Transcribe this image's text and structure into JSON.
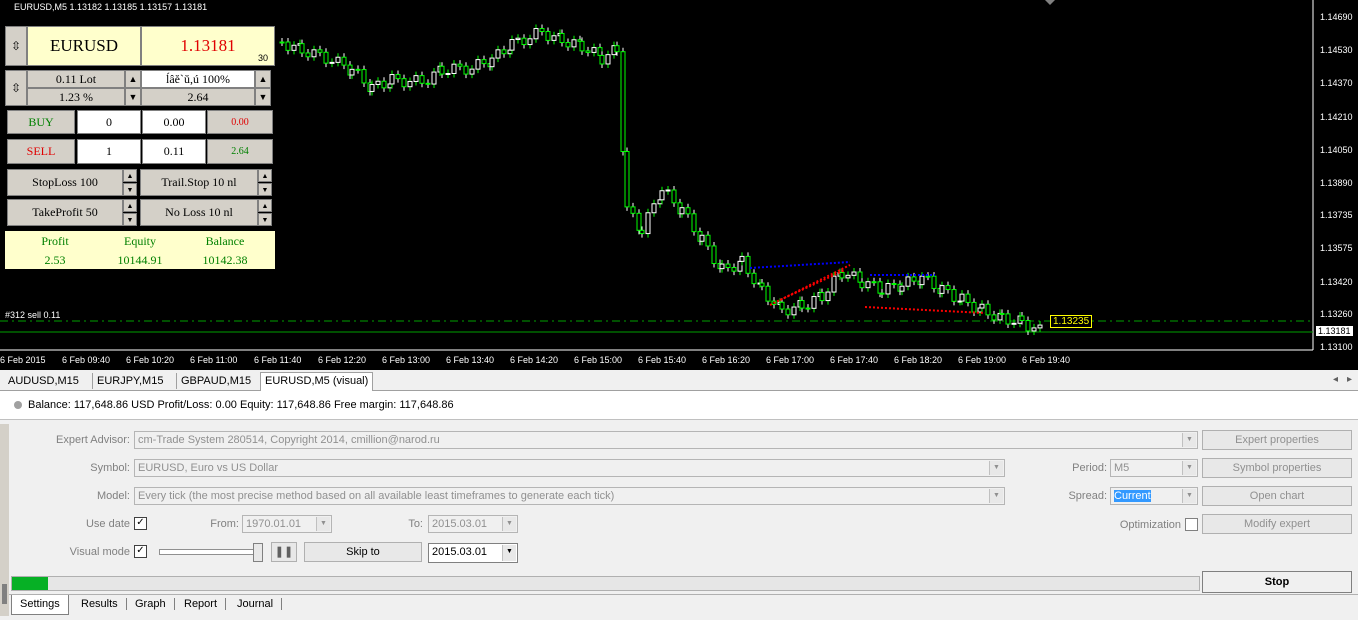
{
  "chart": {
    "symbol_line": "EURUSD,M5  1.13182 1.13185 1.13157 1.13181",
    "price_axis": [
      "1.14690",
      "1.14530",
      "1.14370",
      "1.14210",
      "1.14050",
      "1.13890",
      "1.13735",
      "1.13575",
      "1.13420",
      "1.13260",
      "1.13181",
      "1.13100"
    ],
    "time_axis": [
      "6 Feb 2015",
      "6 Feb 09:40",
      "6 Feb 10:20",
      "6 Feb 11:00",
      "6 Feb 11:40",
      "6 Feb 12:20",
      "6 Feb 13:00",
      "6 Feb 13:40",
      "6 Feb 14:20",
      "6 Feb 15:00",
      "6 Feb 15:40",
      "6 Feb 16:20",
      "6 Feb 17:00",
      "6 Feb 17:40",
      "6 Feb 18:20",
      "6 Feb 19:00",
      "6 Feb 19:40"
    ],
    "order_line_label": "#312 sell 0.11",
    "order_price_tag": "1.13235",
    "current_price_tag": "1.13181",
    "colors": {
      "background": "#000000",
      "bull_candle": "#ffffff",
      "bear_candle": "#00ff00",
      "buy_arrow": "#0000ff",
      "sell_arrow": "#ff0000",
      "order_line": "#00a000"
    }
  },
  "panel": {
    "symbol": "EURUSD",
    "price": "1.13181",
    "price_sub": "30",
    "lot": "0.11 Lot",
    "risk_text": "ĺâĕ`ŭ,ú 100%",
    "percent": "1.23 %",
    "value_264": "2.64",
    "buy_label": "BUY",
    "buy_count": "0",
    "buy_lots": "0.00",
    "buy_profit": "0.00",
    "sell_label": "SELL",
    "sell_count": "1",
    "sell_lots": "0.11",
    "sell_profit": "2.64",
    "stoploss": "StopLoss 100",
    "trailstop": "Trail.Stop 10 nl",
    "takeprofit": "TakeProfit 50",
    "noloss": "No Loss 10 nl",
    "profit_label": "Profit",
    "equity_label": "Equity",
    "balance_label": "Balance",
    "profit_value": "2.53",
    "equity_value": "10144.91",
    "balance_value": "10142.38"
  },
  "chart_tabs": [
    "AUDUSD,M15",
    "EURJPY,M15",
    "GBPAUD,M15",
    "EURUSD,M5 (visual)"
  ],
  "status": "Balance: 117,648.86 USD  Profit/Loss: 0.00  Equity: 117,648.86  Free margin: 117,648.86",
  "tester": {
    "expert_label": "Expert Advisor:",
    "expert_value": "cm-Trade System 280514, Copyright 2014, cmillion@narod.ru",
    "symbol_label": "Symbol:",
    "symbol_value": "EURUSD, Euro vs US Dollar",
    "model_label": "Model:",
    "model_value": "Every tick (the most precise method based on all available least timeframes to generate each tick)",
    "use_date_label": "Use date",
    "from_label": "From:",
    "from_value": "1970.01.01",
    "to_label": "To:",
    "to_value": "2015.03.01",
    "visual_label": "Visual mode",
    "skip_to": "Skip to",
    "skip_date": "2015.03.01",
    "period_label": "Period:",
    "period_value": "M5",
    "spread_label": "Spread:",
    "spread_value": "Current",
    "optimization_label": "Optimization",
    "expert_props": "Expert properties",
    "symbol_props": "Symbol properties",
    "open_chart": "Open chart",
    "modify_expert": "Modify expert",
    "stop": "Stop",
    "progress": 0.03
  },
  "bottom_tabs": [
    "Settings",
    "Results",
    "Graph",
    "Report",
    "Journal"
  ]
}
